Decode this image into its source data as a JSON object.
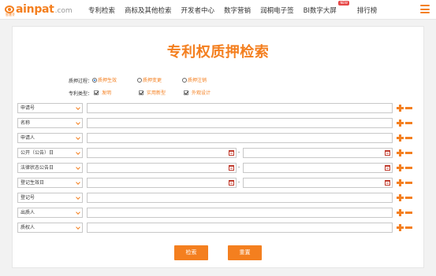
{
  "logo": {
    "brand": "ainpat",
    "domain": ".com",
    "tagline": "智慧芽"
  },
  "nav": {
    "items": [
      "专利检索",
      "商标及其他检索",
      "开发者中心",
      "数字营销",
      "润桐电子签",
      "BI数字大屏",
      "排行榜"
    ],
    "new_badge": "NEW"
  },
  "page": {
    "title": "专利权质押检索"
  },
  "pledge_process": {
    "label": "质押过程：",
    "options": [
      {
        "label": "质押生效",
        "selected": true
      },
      {
        "label": "质押变更",
        "selected": false
      },
      {
        "label": "质押注销",
        "selected": false
      }
    ]
  },
  "patent_type": {
    "label": "专利类型：",
    "options": [
      {
        "label": "发明",
        "checked": true
      },
      {
        "label": "实用新型",
        "checked": true
      },
      {
        "label": "外观设计",
        "checked": true
      }
    ]
  },
  "fields": [
    {
      "label": "申请号",
      "type": "text"
    },
    {
      "label": "名称",
      "type": "text"
    },
    {
      "label": "申请人",
      "type": "text"
    },
    {
      "label": "公开（公告）日",
      "type": "date-range"
    },
    {
      "label": "法律状态公告日",
      "type": "date-range"
    },
    {
      "label": "登记生效日",
      "type": "date-range"
    },
    {
      "label": "登记号",
      "type": "text"
    },
    {
      "label": "出质人",
      "type": "text"
    },
    {
      "label": "质权人",
      "type": "text"
    }
  ],
  "range_separator": "-",
  "buttons": {
    "search": "检索",
    "reset": "重置"
  },
  "colors": {
    "accent": "#f47f1f",
    "radio_dot": "#1e7be0",
    "calendar": "#c0392b"
  }
}
